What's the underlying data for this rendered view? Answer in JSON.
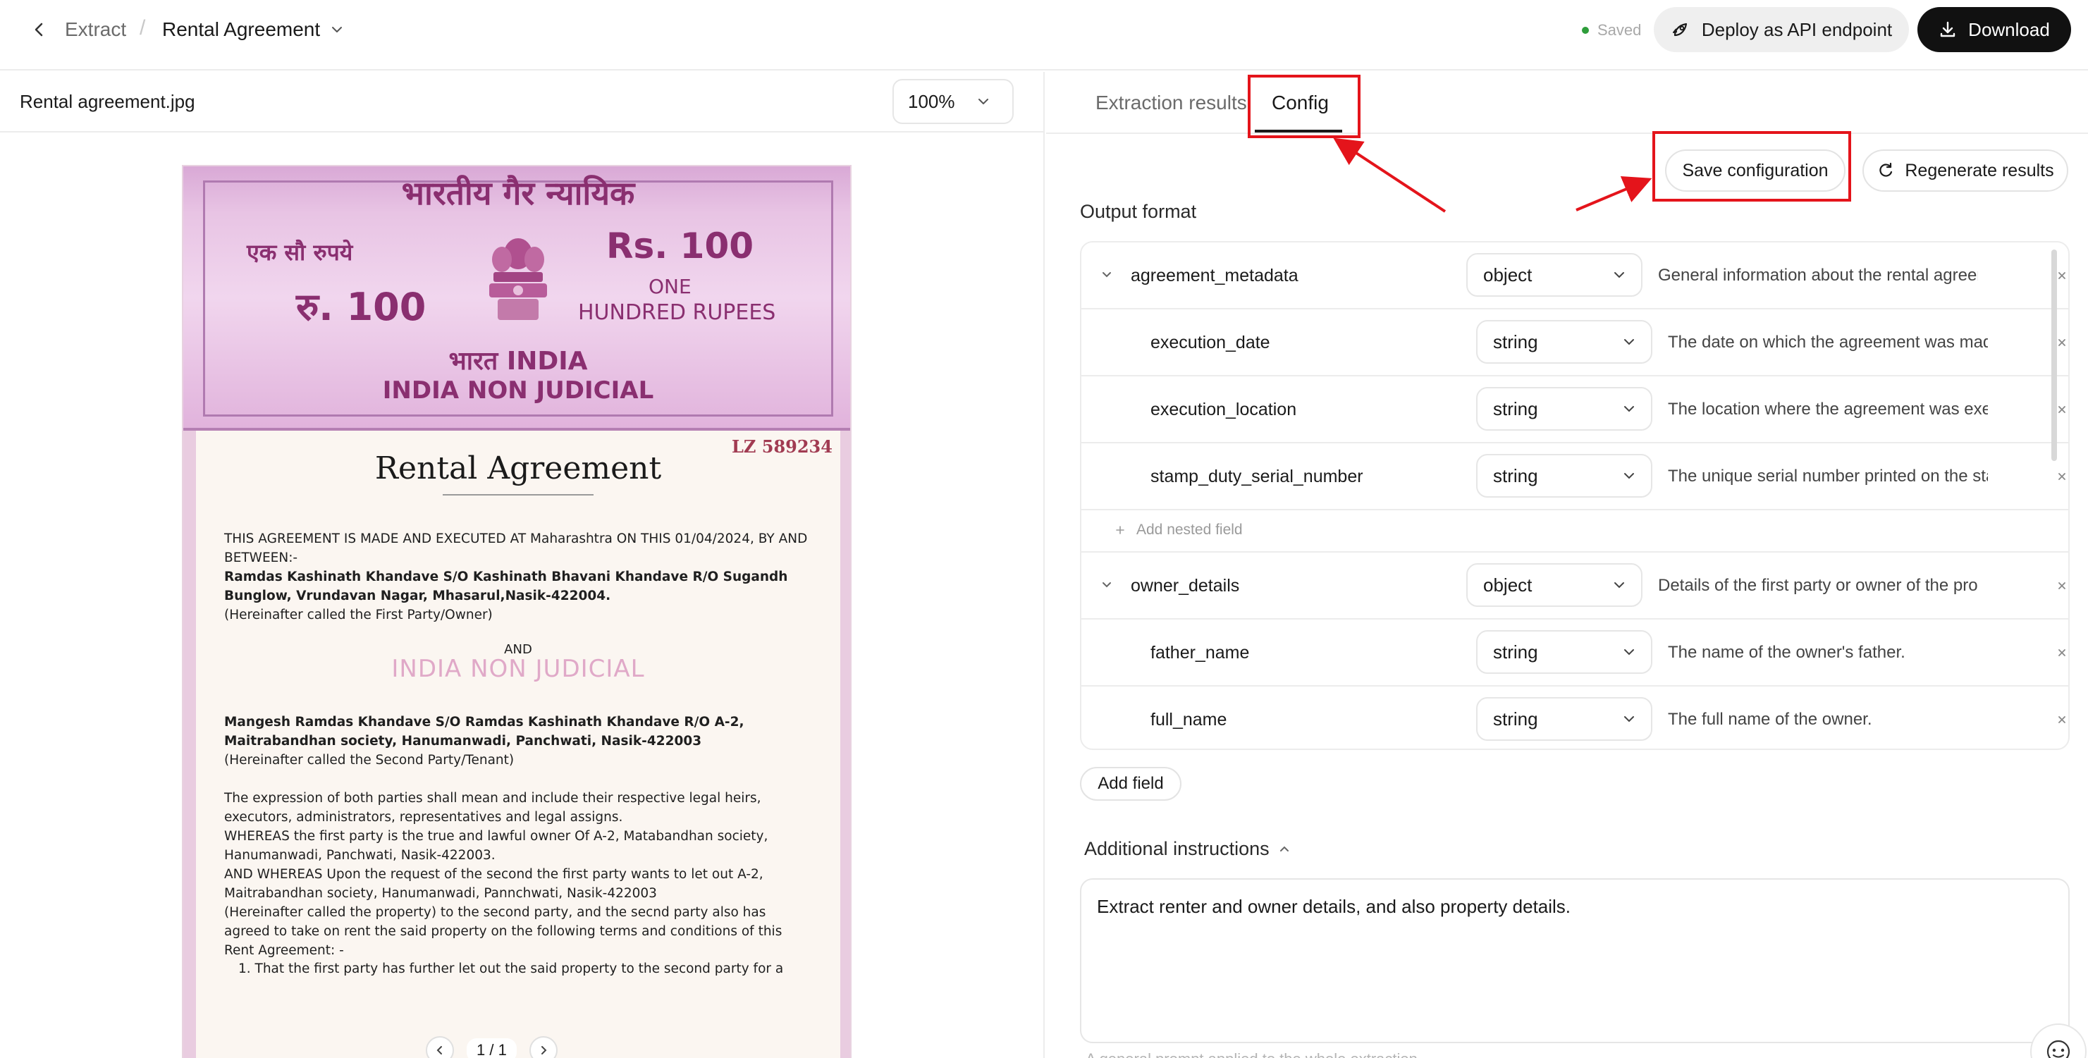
{
  "header": {
    "breadcrumb_root": "Extract",
    "breadcrumb_separator": "/",
    "document_title": "Rental Agreement",
    "status": "Saved",
    "deploy_label": "Deploy as API endpoint",
    "download_label": "Download"
  },
  "viewer": {
    "file_name": "Rental agreement.jpg",
    "zoom": "100%",
    "page_indicator": "1 / 1"
  },
  "document": {
    "stamp_title_hi": "भारतीय गैर न्यायिक",
    "stamp_value_hi": "एक सौ रुपये",
    "stamp_rs": "Rs. 100",
    "stamp_ru": "रु. 100",
    "stamp_one": "ONE",
    "stamp_hundred": "HUNDRED RUPEES",
    "stamp_india": "भारत INDIA",
    "stamp_non_judicial": "INDIA NON JUDICIAL",
    "serial": "LZ 589234",
    "title": "Rental Agreement",
    "watermark": "INDIA NON JUDICIAL",
    "and_label": "AND",
    "para1": "THIS AGREEMENT IS MADE AND EXECUTED AT Maharashtra ON THIS 01/04/2024, BY AND BETWEEN:-",
    "party1": "Ramdas Kashinath Khandave S/O Kashinath Bhavani Khandave R/O Sugandh Bunglow, Vrundavan Nagar, Mhasarul,Nasik-422004.",
    "party1_note": "(Hereinafter called the First Party/Owner)",
    "party2": "Mangesh Ramdas Khandave  S/O Ramdas Kashinath Khandave R/O A-2, Maitrabandhan society, Hanumanwadi, Panchwati, Nasik-422003",
    "party2_note": "(Hereinafter called the Second Party/Tenant)",
    "para2": "The expression of both parties shall mean and include their respective legal heirs, executors, administrators, representatives and legal assigns.",
    "para3": "WHEREAS the first party is the true and lawful owner Of A-2, Matabandhan society, Hanumanwadi, Panchwati, Nasik-422003.",
    "para4": "AND WHEREAS Upon the request of the second the first party wants to let out A-2, Maitrabandhan society, Hanumanwadi, Pannchwati, Nasik-422003",
    "para5": "(Hereinafter called the property) to the second party, and the secnd party also has agreed to take on rent the said property on the following terms and conditions of this Rent Agreement: -",
    "clause1": "1.   That the first party has further let out the said property to the second party for a"
  },
  "config": {
    "tabs": [
      "Extraction results",
      "Config"
    ],
    "active_tab": "Config",
    "save_label": "Save configuration",
    "regenerate_label": "Regenerate results",
    "output_format_label": "Output format",
    "fields": [
      {
        "name": "agreement_metadata",
        "type": "object",
        "description": "General information about the rental agreement",
        "nested": false
      },
      {
        "name": "execution_date",
        "type": "string",
        "description": "The date on which the agreement was made",
        "nested": true
      },
      {
        "name": "execution_location",
        "type": "string",
        "description": "The location where the agreement was executed",
        "nested": true
      },
      {
        "name": "stamp_duty_serial_number",
        "type": "string",
        "description": "The unique serial number printed on the stamp paper",
        "nested": true
      },
      {
        "name": "owner_details",
        "type": "object",
        "description": "Details of the first party or owner of the property",
        "nested": false
      },
      {
        "name": "father_name",
        "type": "string",
        "description": "The name of the owner's father.",
        "nested": true
      },
      {
        "name": "full_name",
        "type": "string",
        "description": "The full name of the owner.",
        "nested": true
      }
    ],
    "add_nested_label": "Add nested field",
    "add_field_label": "Add field",
    "additional_instructions_label": "Additional instructions",
    "additional_instructions_value": "Extract renter and owner details, and also property details.",
    "additional_instructions_hint": "A general prompt applied to the whole extraction"
  },
  "annotations": {
    "highlight_color": "#e4141b"
  }
}
